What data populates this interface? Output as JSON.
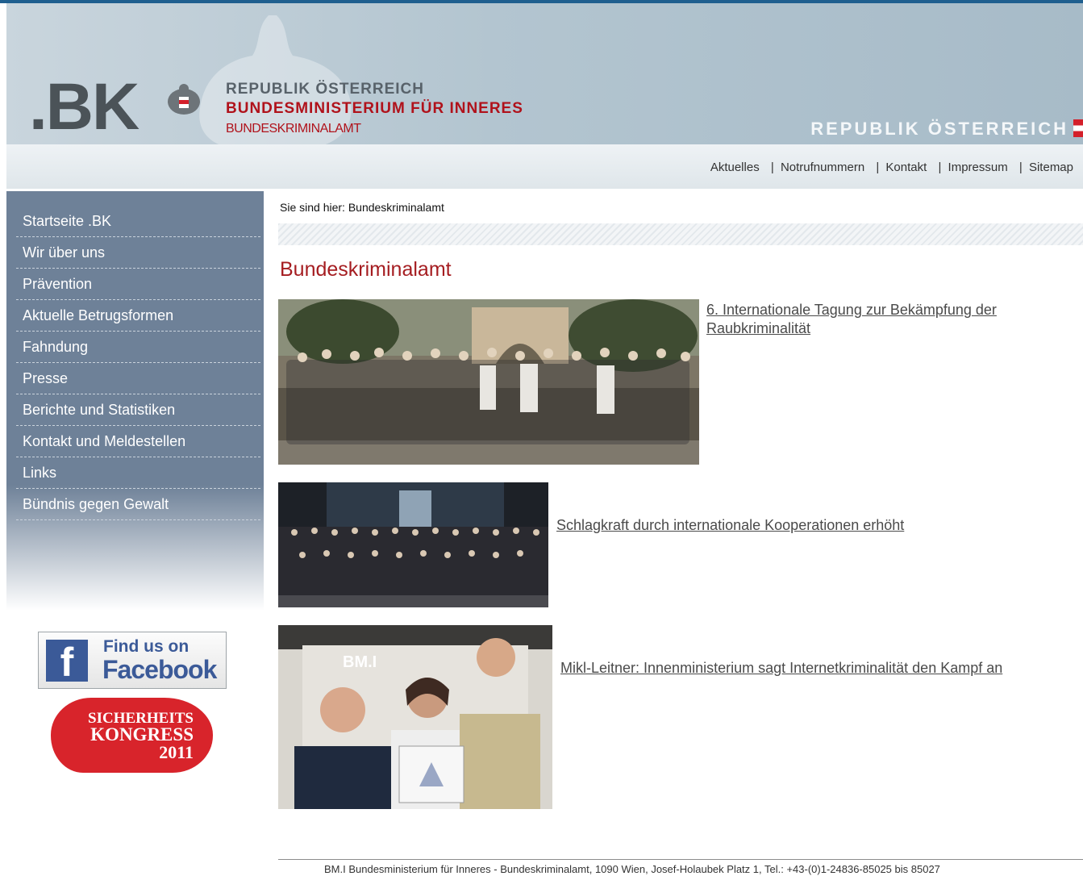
{
  "header": {
    "logo_text": ".BK",
    "ministry_line1": "REPUBLIK ÖSTERREICH",
    "ministry_line2": "BUNDESMINISTERIUM FÜR INNERES",
    "ministry_line3": "BUNDESKRIMINALAMT",
    "republic_right": "REPUBLIK ÖSTERREICH"
  },
  "top_nav": {
    "items": [
      "Aktuelles",
      "Notrufnummern",
      "Kontakt",
      "Impressum",
      "Sitemap"
    ],
    "separator": "|"
  },
  "sidebar": {
    "items": [
      "Startseite .BK",
      "Wir über uns",
      "Prävention",
      "Aktuelle Betrugsformen",
      "Fahndung",
      "Presse",
      "Berichte und Statistiken",
      "Kontakt und Meldestellen",
      "Links",
      "Bündnis gegen Gewalt"
    ]
  },
  "facebook_badge": {
    "line1": "Find us on",
    "line2": "Facebook",
    "icon": "facebook-icon"
  },
  "kongress_badge": {
    "line1": "SICHERHEITS",
    "line2": "KONGRESS",
    "line3": "2011"
  },
  "main": {
    "breadcrumb": "Sie sind hier: Bundeskriminalamt",
    "title": "Bundeskriminalamt",
    "articles": [
      {
        "link_line1": "6. Internationale Tagung zur Bekämpfung der",
        "link_line2": "Raubkriminalität"
      },
      {
        "link": "Schlagkraft durch internationale Kooperationen erhöht"
      },
      {
        "link": "Mikl-Leitner: Innenministerium sagt Internetkriminalität den Kampf an",
        "photo_sign": "BM.I"
      }
    ]
  },
  "footer": {
    "text": "BM.I Bundesministerium für Inneres - Bundeskriminalamt, 1090 Wien, Josef-Holaubek Platz 1, Tel.: +43-(0)1-24836-85025 bis 85027"
  },
  "colors": {
    "accent_red": "#a51d21",
    "sidebar_blue": "#6e8198",
    "facebook_blue": "#3b5a98"
  }
}
